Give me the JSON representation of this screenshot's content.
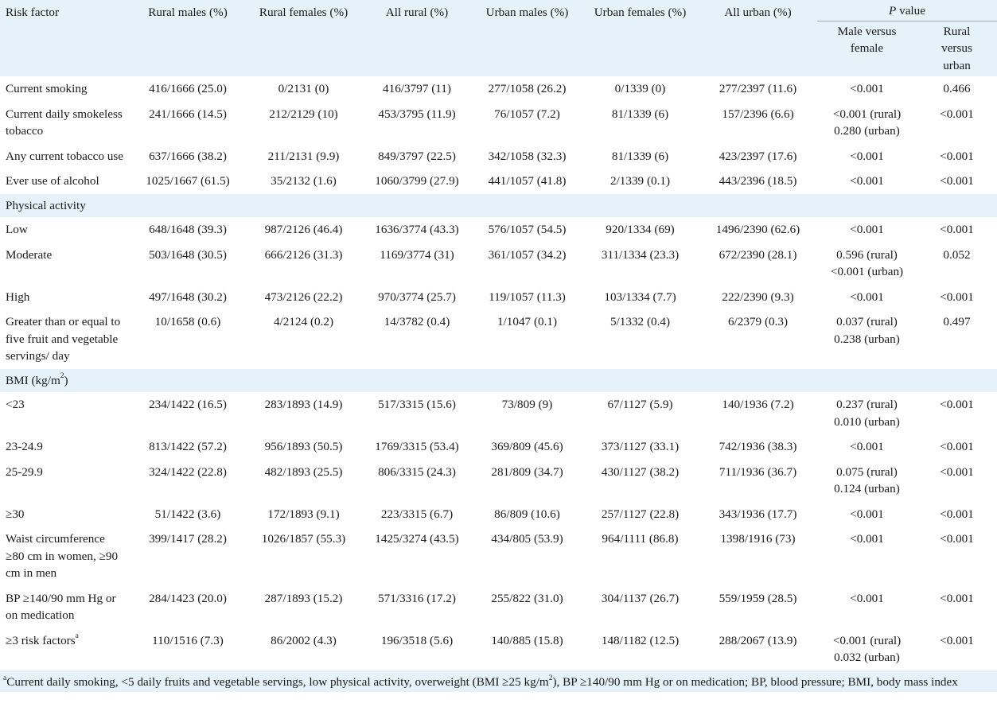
{
  "headers": {
    "risk_factor": "Risk factor",
    "rural_males": "Rural males (%)",
    "rural_females": "Rural females (%)",
    "all_rural": "All rural (%)",
    "urban_males": "Urban males (%)",
    "urban_females": "Urban females (%)",
    "all_urban": "All urban (%)",
    "p_value_italic": "P",
    "p_value_rest": " value",
    "male_vs_female": "Male versus female",
    "rural_vs_urban": "Rural versus urban"
  },
  "rows": [
    {
      "label": "Current smoking",
      "rm": "416/1666 (25.0)",
      "rf": "0/2131 (0)",
      "ar": "416/3797 (11)",
      "um": "277/1058 (26.2)",
      "uf": "0/1339 (0)",
      "au": "277/2397 (11.6)",
      "mvf": "<0.001",
      "rvu": "0.466"
    },
    {
      "label": "Current daily smokeless tobacco",
      "rm": "241/1666 (14.5)",
      "rf": "212/2129 (10)",
      "ar": "453/3795 (11.9)",
      "um": "76/1057 (7.2)",
      "uf": "81/1339 (6)",
      "au": "157/2396 (6.6)",
      "mvf": "<0.001 (rural) 0.280 (urban)",
      "rvu": "<0.001"
    },
    {
      "label": "Any current tobacco use",
      "rm": "637/1666 (38.2)",
      "rf": "211/2131 (9.9)",
      "ar": "849/3797 (22.5)",
      "um": "342/1058 (32.3)",
      "uf": "81/1339 (6)",
      "au": "423/2397 (17.6)",
      "mvf": "<0.001",
      "rvu": "<0.001"
    },
    {
      "label": "Ever use of alcohol",
      "rm": "1025/1667 (61.5)",
      "rf": "35/2132 (1.6)",
      "ar": "1060/3799 (27.9)",
      "um": "441/1057 (41.8)",
      "uf": "2/1339 (0.1)",
      "au": "443/2396 (18.5)",
      "mvf": "<0.001",
      "rvu": "<0.001"
    }
  ],
  "section_physical": "Physical activity",
  "rows_physical": [
    {
      "label": "Low",
      "rm": "648/1648 (39.3)",
      "rf": "987/2126 (46.4)",
      "ar": "1636/3774 (43.3)",
      "um": "576/1057 (54.5)",
      "uf": "920/1334 (69)",
      "au": "1496/2390 (62.6)",
      "mvf": "<0.001",
      "rvu": "<0.001"
    },
    {
      "label": "Moderate",
      "rm": "503/1648 (30.5)",
      "rf": "666/2126 (31.3)",
      "ar": "1169/3774 (31)",
      "um": "361/1057 (34.2)",
      "uf": "311/1334 (23.3)",
      "au": "672/2390 (28.1)",
      "mvf": "0.596 (rural) <0.001 (urban)",
      "rvu": "0.052"
    },
    {
      "label": "High",
      "rm": "497/1648 (30.2)",
      "rf": "473/2126 (22.2)",
      "ar": "970/3774 (25.7)",
      "um": "119/1057 (11.3)",
      "uf": "103/1334 (7.7)",
      "au": "222/2390 (9.3)",
      "mvf": "<0.001",
      "rvu": "<0.001"
    },
    {
      "label": "Greater than or equal to five fruit and vegetable servings/ day",
      "rm": "10/1658 (0.6)",
      "rf": "4/2124 (0.2)",
      "ar": "14/3782 (0.4)",
      "um": "1/1047 (0.1)",
      "uf": "5/1332 (0.4)",
      "au": "6/2379 (0.3)",
      "mvf": "0.037 (rural) 0.238 (urban)",
      "rvu": "0.497"
    }
  ],
  "section_bmi_prefix": "BMI (kg/m",
  "section_bmi_sup": "2",
  "section_bmi_suffix": ")",
  "rows_bmi": [
    {
      "label": "<23",
      "rm": "234/1422 (16.5)",
      "rf": "283/1893 (14.9)",
      "ar": "517/3315 (15.6)",
      "um": "73/809 (9)",
      "uf": "67/1127 (5.9)",
      "au": "140/1936 (7.2)",
      "mvf": "0.237 (rural) 0.010 (urban)",
      "rvu": "<0.001"
    },
    {
      "label": "23-24.9",
      "rm": "813/1422 (57.2)",
      "rf": "956/1893 (50.5)",
      "ar": "1769/3315 (53.4)",
      "um": "369/809 (45.6)",
      "uf": "373/1127 (33.1)",
      "au": "742/1936 (38.3)",
      "mvf": "<0.001",
      "rvu": "<0.001"
    },
    {
      "label": "25-29.9",
      "rm": "324/1422 (22.8)",
      "rf": "482/1893 (25.5)",
      "ar": "806/3315 (24.3)",
      "um": "281/809 (34.7)",
      "uf": "430/1127 (38.2)",
      "au": "711/1936 (36.7)",
      "mvf": "0.075 (rural) 0.124 (urban)",
      "rvu": "<0.001"
    },
    {
      "label": "≥30",
      "rm": "51/1422 (3.6)",
      "rf": "172/1893 (9.1)",
      "ar": "223/3315 (6.7)",
      "um": "86/809 (10.6)",
      "uf": "257/1127 (22.8)",
      "au": "343/1936 (17.7)",
      "mvf": "<0.001",
      "rvu": "<0.001"
    },
    {
      "label": "Waist circumference ≥80 cm in women, ≥90 cm in men",
      "rm": "399/1417 (28.2)",
      "rf": "1026/1857 (55.3)",
      "ar": "1425/3274 (43.5)",
      "um": "434/805 (53.9)",
      "uf": "964/1111 (86.8)",
      "au": "1398/1916 (73)",
      "mvf": "<0.001",
      "rvu": "<0.001"
    },
    {
      "label": "BP ≥140/90 mm Hg or on medication",
      "rm": "284/1423 (20.0)",
      "rf": "287/1893 (15.2)",
      "ar": "571/3316 (17.2)",
      "um": "255/822 (31.0)",
      "uf": "304/1137 (26.7)",
      "au": "559/1959 (28.5)",
      "mvf": "<0.001",
      "rvu": "<0.001"
    }
  ],
  "last_row": {
    "label": "≥3 risk factors",
    "label_sup": "a",
    "rm": "110/1516 (7.3)",
    "rf": "86/2002 (4.3)",
    "ar": "196/3518 (5.6)",
    "um": "140/885 (15.8)",
    "uf": "148/1182 (12.5)",
    "au": "288/2067 (13.9)",
    "mvf": "<0.001 (rural) 0.032 (urban)",
    "rvu": "<0.001"
  },
  "footnote": {
    "sup_a": "a",
    "text1": "Current daily smoking, <5 daily fruits and vegetable servings, low physical activity, overweight (BMI ≥25 kg/m",
    "sup_2": "2",
    "text2": "), BP ≥140/90 mm Hg or on medication; BP, blood pressure; BMI, body mass index"
  }
}
